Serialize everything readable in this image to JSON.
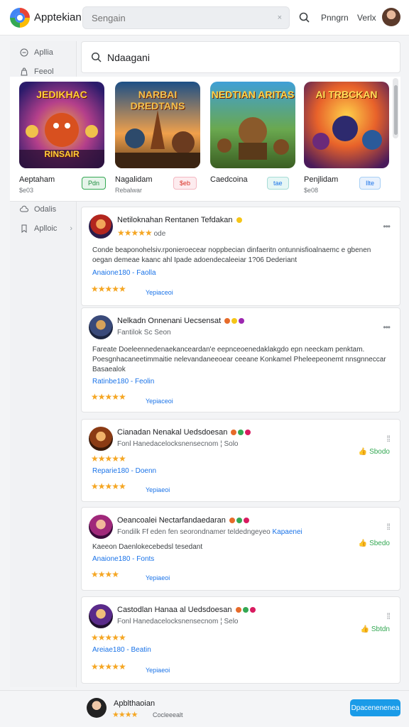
{
  "app": {
    "title": "Apptekian"
  },
  "search": {
    "placeholder": "Sengain",
    "clear": "×"
  },
  "header": {
    "link1": "Pnngrn",
    "link2": "Verlx"
  },
  "sidebar": {
    "items": [
      {
        "label": "Apllia",
        "icon": "minus-circle-icon"
      },
      {
        "label": "Feeol",
        "icon": "bag-icon"
      },
      {
        "label": "Odalis",
        "icon": "cloud-icon"
      },
      {
        "label": "Aplloic",
        "icon": "bookmark-icon",
        "chevron": "›"
      }
    ]
  },
  "main_search": {
    "value": "Ndaagani"
  },
  "featured": [
    {
      "name": "Aeptaham",
      "sub": "$e03",
      "button": "Pdn",
      "art": "JEDIKHAC",
      "art_bottom": "RINSAIR",
      "button_color": "#34a853"
    },
    {
      "name": "Nagalidam",
      "sub": "Rebalwar",
      "button": "$eb",
      "art": "NARBAI DREDTANS",
      "art_bottom": "",
      "button_color": "#e8475f"
    },
    {
      "name": "Caedcoina",
      "sub": "",
      "button": "tae",
      "art": "NEDTIAN ARITAS",
      "art_bottom": "",
      "button_color": "#26a69a"
    },
    {
      "name": "Penjlidam",
      "sub": "$e08",
      "button": "Ilte",
      "art": "AI TRBCKAN",
      "art_bottom": "",
      "button_color": "#1a73e8"
    }
  ],
  "reviews": [
    {
      "title": "Netiloknahan Rentanen Tefdakan",
      "sub": "ode",
      "stars": "★★★★★",
      "body": "Conde beaponohelsiv.rponieroecear noppbecian dinfaeritn ontunnisfioalnaemc e gbenen oegan demeae kaanc ahl Ipade adoendecaleeiar 1?06  Dederiant",
      "meta": "Anaione180 -",
      "meta2": "Faolla",
      "rating": "★★★★★",
      "reply": "Yepiaceoi",
      "helpful": ""
    },
    {
      "title": "Nelkadn Onnenani Uecsensat",
      "sub": "Fantilok  Sc Seon",
      "stars": "",
      "body": "Fareate  Doeleennedenaekanceardan'e eepnceoenedaklakgdo epn neeckam  penktam. Poesgnhacaneetimmaitie nelevandaneeoear ceeane  Konkamel Pheleepeonemt nnsgnneccar Basaealok",
      "meta": "Ratinbe180 -",
      "meta2": "Feolin",
      "rating": "★★★★★",
      "reply": "Yepiaceoi",
      "helpful": ""
    },
    {
      "title": "Cianadan Nenakal Uedsdoesan",
      "sub": "Fonl Hanedacelocksnensecnom ¦  Solo",
      "stars": "★★★★★",
      "body": "",
      "meta": "Reparie180 -",
      "meta2": "Doenn",
      "rating": "★★★★★",
      "reply": "Yepiaeoi",
      "helpful": "Sbodo"
    },
    {
      "title": "Oeancoalei Nectarfandaedaran",
      "sub": "Fondilk  Ff eden fen seorondnamer teldedngeyeo",
      "stars": "",
      "body": "Kaeeon Daenlokecebedsl tesedant",
      "meta": "Anaione180 -",
      "meta2": "Fonts",
      "rating": "★★★★",
      "reply": "Yepiaeoi",
      "helpful": "Sbedo",
      "sub_link": "Kapaenei"
    },
    {
      "title": "Castodlan Hanaa al Uedsdoesan",
      "sub": "Fonl Hanedacelocksnensecnom ¦  Selo",
      "stars": "★★★★★",
      "body": "",
      "meta": "Areiae180 -",
      "meta2": "Beatin",
      "rating": "★★★★★",
      "reply": "Yepiaeoi",
      "helpful": "Sbtdn"
    }
  ],
  "bottom": {
    "name": "Apblthaoian",
    "stars": "★★★★",
    "sub": "Cocleeealt",
    "button": "Dpacenenenea"
  },
  "colors": {
    "accent": "#1a9be8",
    "star": "#f5a623",
    "positive": "#34a853"
  }
}
